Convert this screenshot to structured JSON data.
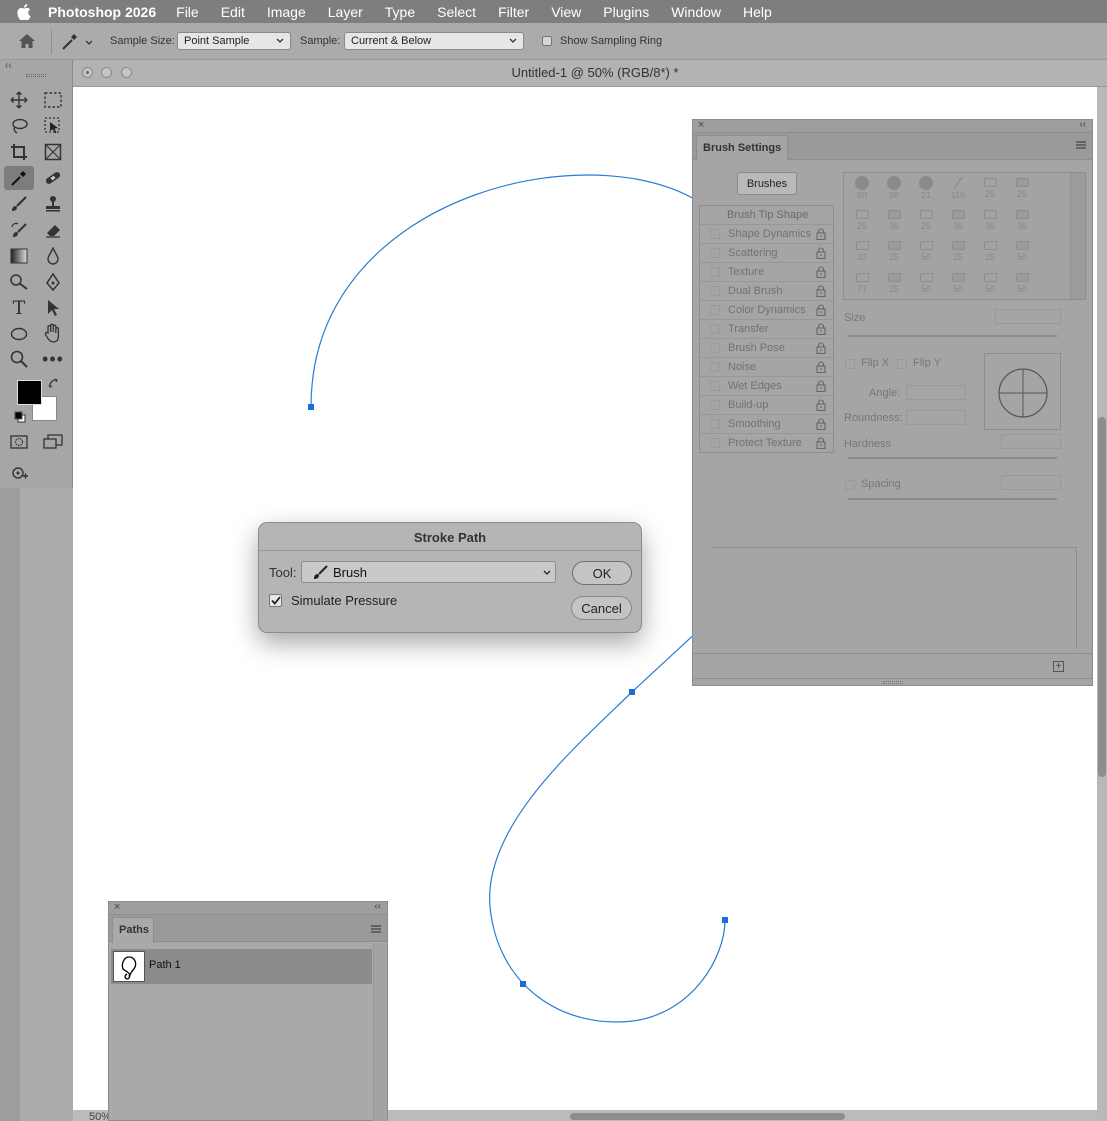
{
  "menubar": {
    "app_name": "Photoshop 2026",
    "items": [
      "File",
      "Edit",
      "Image",
      "Layer",
      "Type",
      "Select",
      "Filter",
      "View",
      "Plugins",
      "Window",
      "Help"
    ]
  },
  "options": {
    "sample_size_label": "Sample Size:",
    "sample_size_value": "Point Sample",
    "sample_label": "Sample:",
    "sample_value": "Current & Below",
    "show_ring_label": "Show Sampling Ring"
  },
  "document": {
    "title": "Untitled-1 @ 50% (RGB/8*) *",
    "zoom_fragment": "50%"
  },
  "brush_settings": {
    "tab": "Brush Settings",
    "brushes_button": "Brushes",
    "options": [
      {
        "label": "Brush Tip Shape",
        "lock": false
      },
      {
        "label": "Shape Dynamics",
        "lock": true
      },
      {
        "label": "Scattering",
        "lock": true
      },
      {
        "label": "Texture",
        "lock": true
      },
      {
        "label": "Dual Brush",
        "lock": true
      },
      {
        "label": "Color Dynamics",
        "lock": true
      },
      {
        "label": "Transfer",
        "lock": true
      },
      {
        "label": "Brush Pose",
        "lock": true
      },
      {
        "label": "Noise",
        "lock": true
      },
      {
        "label": "Wet Edges",
        "lock": true
      },
      {
        "label": "Build-up",
        "lock": true
      },
      {
        "label": "Smoothing",
        "lock": true
      },
      {
        "label": "Protect Texture",
        "lock": true
      }
    ],
    "tip_sizes": [
      "80",
      "98",
      "21",
      "116",
      "25",
      "25",
      "25",
      "36",
      "25",
      "36",
      "36",
      "36",
      "32",
      "25",
      "50",
      "25",
      "25",
      "50",
      "71",
      "25",
      "50",
      "50",
      "50",
      "50"
    ],
    "size_label": "Size",
    "flip_x": "Flip X",
    "flip_y": "Flip Y",
    "angle_label": "Angle:",
    "roundness_label": "Roundness:",
    "hardness_label": "Hardness",
    "spacing_label": "Spacing"
  },
  "stroke_dialog": {
    "title": "Stroke Path",
    "tool_label": "Tool:",
    "tool_value": "Brush",
    "simulate_pressure": "Simulate Pressure",
    "simulate_checked": true,
    "ok": "OK",
    "cancel": "Cancel"
  },
  "paths_panel": {
    "tab": "Paths",
    "path_name": "Path 1"
  },
  "colors": {
    "path_stroke": "#2a7bd4",
    "anchor": "#1a6fd6",
    "foreground": "#000000",
    "background": "#ffffff"
  }
}
